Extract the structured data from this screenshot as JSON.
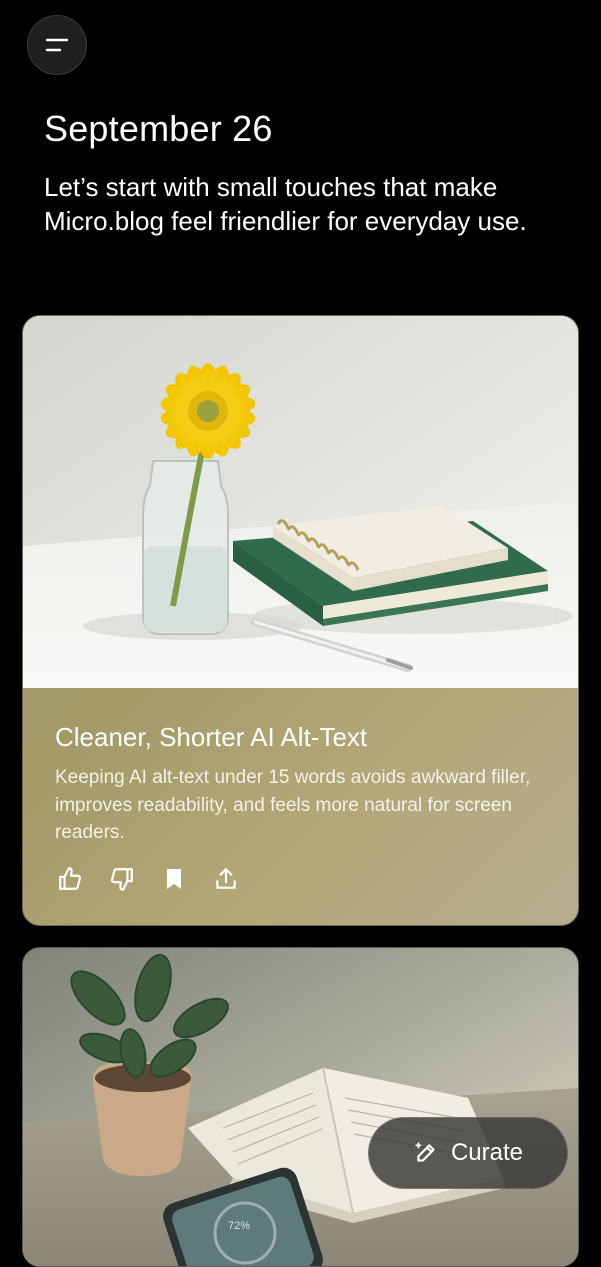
{
  "header": {
    "menu_icon": "menu-icon",
    "date": "September 26",
    "intro": "Let’s start with small touches that make Micro.blog feel friendlier for everyday use."
  },
  "cards": [
    {
      "image": "photo-yellow-gerbera-in-glass-vase-with-notebook-and-books",
      "title": "Cleaner, Shorter AI Alt-Text",
      "description": "Keeping AI alt-text under 15 words avoids awkward filler, improves readability, and feels more natural for screen readers.",
      "actions": [
        {
          "icon": "thumbs-up-icon"
        },
        {
          "icon": "thumbs-down-icon"
        },
        {
          "icon": "bookmark-icon"
        },
        {
          "icon": "share-icon"
        }
      ],
      "accent_color": "#a39a68"
    },
    {
      "image": "photo-potted-plant-open-book-and-phone-on-table",
      "phone_text": "72%"
    }
  ],
  "curate": {
    "icon": "pencil-sparkle-icon",
    "label": "Curate"
  }
}
